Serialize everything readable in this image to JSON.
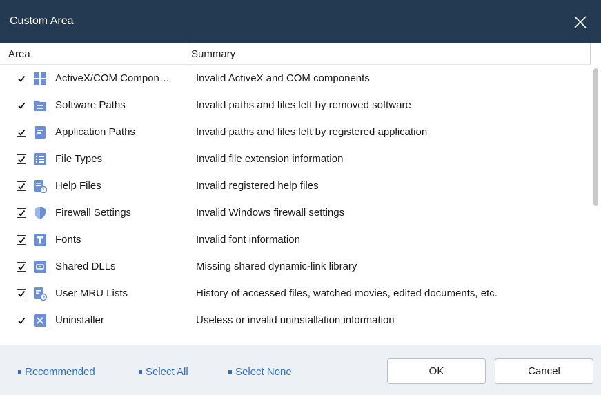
{
  "window": {
    "title": "Custom Area"
  },
  "columns": {
    "area": "Area",
    "summary": "Summary"
  },
  "rows": [
    {
      "area": "ActiveX/COM Compon…",
      "summary": "Invalid ActiveX and COM components",
      "icon": "grid-icon",
      "checked": true
    },
    {
      "area": "Software Paths",
      "summary": "Invalid paths and files left by removed software",
      "icon": "folder-icon",
      "checked": true
    },
    {
      "area": "Application Paths",
      "summary": "Invalid paths and files left by registered application",
      "icon": "document-icon",
      "checked": true
    },
    {
      "area": "File Types",
      "summary": "Invalid file extension information",
      "icon": "list-icon",
      "checked": true
    },
    {
      "area": "Help Files",
      "summary": "Invalid registered help files",
      "icon": "help-file-icon",
      "checked": true
    },
    {
      "area": "Firewall Settings",
      "summary": "Invalid Windows firewall settings",
      "icon": "shield-icon",
      "checked": true
    },
    {
      "area": "Fonts",
      "summary": "Invalid font information",
      "icon": "font-icon",
      "checked": true
    },
    {
      "area": "Shared DLLs",
      "summary": "Missing shared dynamic-link library",
      "icon": "dll-icon",
      "checked": true
    },
    {
      "area": "User MRU Lists",
      "summary": "History of accessed files, watched movies, edited documents, etc.",
      "icon": "history-icon",
      "checked": true
    },
    {
      "area": "Uninstaller",
      "summary": "Useless or invalid uninstallation information",
      "icon": "uninstall-icon",
      "checked": true
    }
  ],
  "footer": {
    "links": [
      "Recommended",
      "Select All",
      "Select None"
    ],
    "ok": "OK",
    "cancel": "Cancel"
  },
  "colors": {
    "titlebar": "#243a52",
    "icon": "#6b8fd6",
    "link": "#2c72c9",
    "footer": "#edf0f4"
  }
}
